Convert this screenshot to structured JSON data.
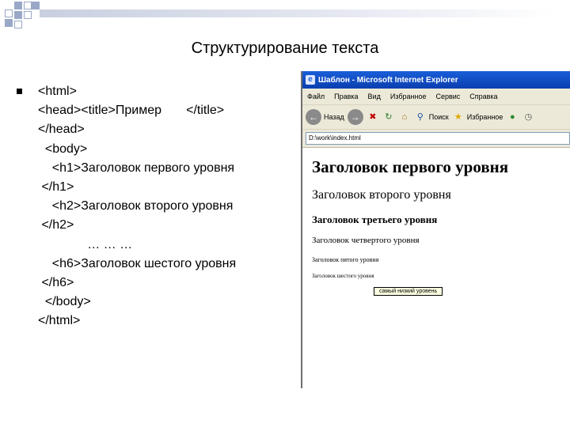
{
  "slide": {
    "title": "Структурирование текста",
    "code_lines": [
      "<html>",
      "<head><title>Пример       </title>",
      "</head>",
      "  <body>",
      "    <h1>Заголовок первого уровня",
      " </h1>",
      "    <h2>Заголовок второго уровня",
      " </h2>",
      "              … … …",
      "    <h6>Заголовок шестого уровня",
      " </h6>",
      "  </body>",
      "</html>"
    ]
  },
  "browser": {
    "window_title": "Шаблон - Microsoft Internet Explorer",
    "menu": [
      "Файл",
      "Правка",
      "Вид",
      "Избранное",
      "Сервис",
      "Справка"
    ],
    "toolbar": {
      "back": "Назад",
      "search": "Поиск",
      "favorites": "Избранное"
    },
    "address": "D:\\work\\index.html",
    "headings": {
      "h1": "Заголовок первого уровня",
      "h2": "Заголовок второго уровня",
      "h3": "Заголовок третьего уровня",
      "h4": "Заголовок четвертого уровня",
      "h5": "Заголовок пятого уровня",
      "h6": "Заголовок шестого уровня"
    },
    "tooltip": "самый низкий уровень"
  },
  "colors": {
    "titlebar": "#0a3fb0",
    "chrome": "#ece9d8",
    "accent_squares": "#9aa8c8"
  }
}
